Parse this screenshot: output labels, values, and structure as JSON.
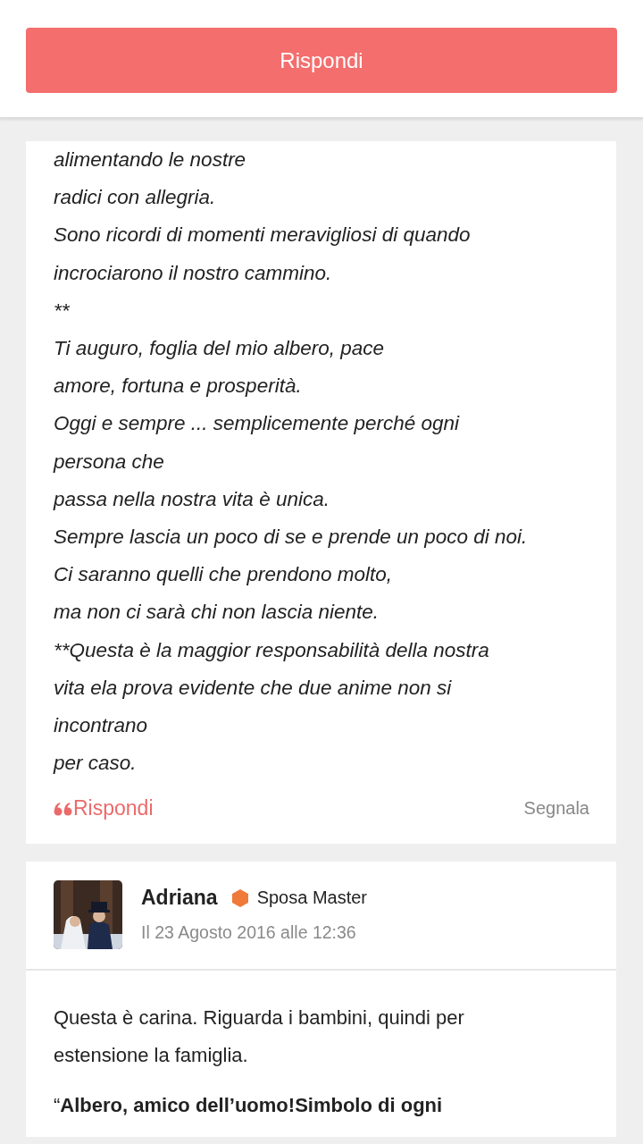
{
  "header": {
    "reply_button": "Rispondi"
  },
  "post": {
    "lines": [
      "alimentando le nostre",
      "radici con allegria.",
      "Sono ricordi di momenti meravigliosi di quando",
      "incrociarono il nostro cammino.",
      "**",
      "Ti auguro, foglia del mio albero, pace",
      "amore, fortuna e prosperità.",
      "Oggi e sempre ... semplicemente perché ogni",
      "persona che",
      "passa nella nostra vita è unica.",
      "Sempre lascia un poco di se e prende un poco di noi.",
      "Ci saranno quelli che prendono molto,",
      "ma non ci sarà chi non lascia niente.",
      "**Questa è la maggior responsabilità della nostra",
      "vita ela prova evidente che due anime non si",
      "incontrano",
      "per caso."
    ],
    "reply": "Rispondi",
    "report": "Segnala"
  },
  "next_post": {
    "author": "Adriana",
    "rank": "Sposa Master",
    "date": "Il 23 Agosto 2016 alle 12:36",
    "paragraphs": [
      "Questa è carina. Riguarda i bambini, quindi per estensione la famiglia.",
      "“**Albero, amico dell’uomo!Simbolo di ogni**"
    ]
  }
}
